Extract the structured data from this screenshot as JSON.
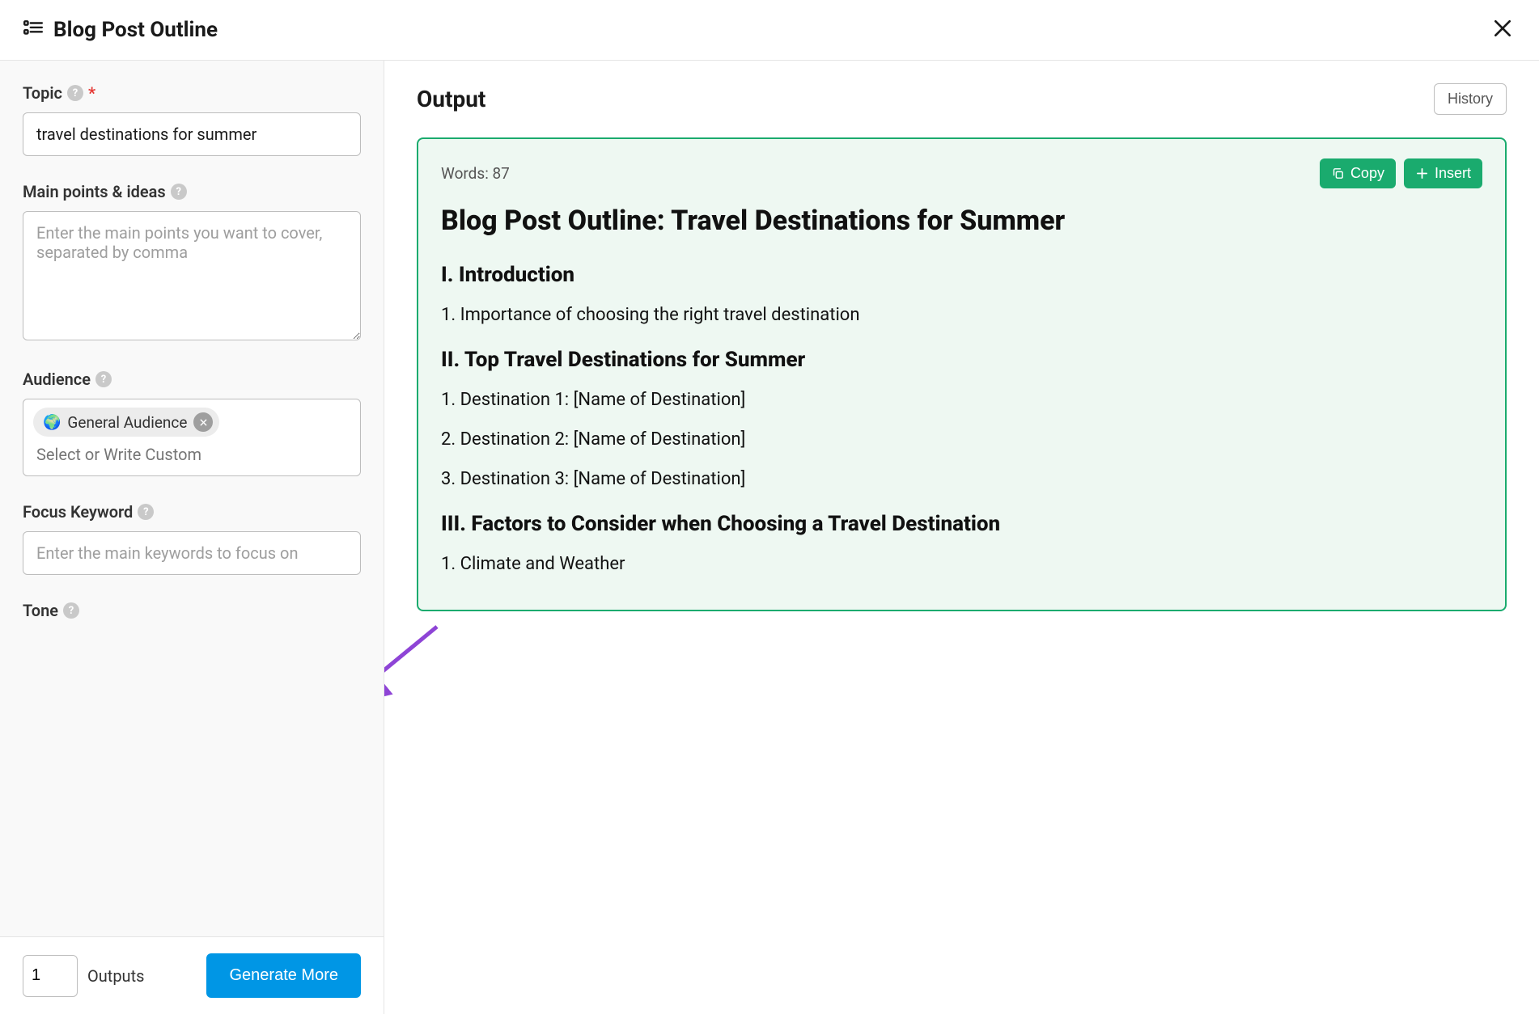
{
  "header": {
    "title": "Blog Post Outline"
  },
  "sidebar": {
    "topic": {
      "label": "Topic",
      "value": "travel destinations for summer"
    },
    "mainPoints": {
      "label": "Main points & ideas",
      "placeholder": "Enter the main points you want to cover, separated by comma"
    },
    "audience": {
      "label": "Audience",
      "chip": {
        "emoji": "🌍",
        "text": "General Audience"
      },
      "placeholder": "Select or Write Custom"
    },
    "focusKeyword": {
      "label": "Focus Keyword",
      "placeholder": "Enter the main keywords to focus on"
    },
    "tone": {
      "label": "Tone"
    },
    "footer": {
      "outputsCount": "1",
      "outputsLabel": "Outputs",
      "generateLabel": "Generate More"
    }
  },
  "output": {
    "heading": "Output",
    "historyLabel": "History",
    "wordsLabel": "Words: 87",
    "copyLabel": "Copy",
    "insertLabel": "Insert",
    "title": "Blog Post Outline: Travel Destinations for Summer",
    "sections": {
      "s1h": "I. Introduction",
      "s1p1": "1. Importance of choosing the right travel destination",
      "s2h": "II. Top Travel Destinations for Summer",
      "s2p1": "1. Destination 1: [Name of Destination]",
      "s2p2": "2. Destination 2: [Name of Destination]",
      "s2p3": "3. Destination 3: [Name of Destination]",
      "s3h": "III. Factors to Consider when Choosing a Travel Destination",
      "s3p1": "1. Climate and Weather"
    }
  }
}
